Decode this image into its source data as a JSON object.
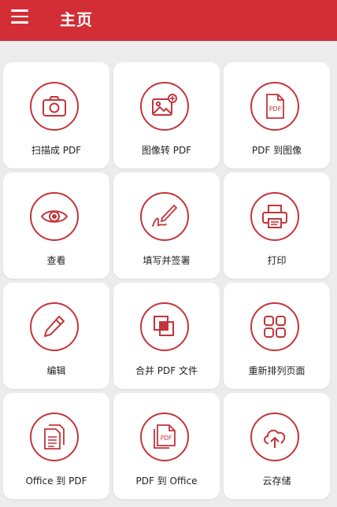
{
  "header": {
    "title": "主页"
  },
  "tiles": [
    {
      "label": "扫描成 PDF",
      "icon": "camera-icon"
    },
    {
      "label": "图像转 PDF",
      "icon": "image-add-icon"
    },
    {
      "label": "PDF 到图像",
      "icon": "pdf-file-icon",
      "icon_text": "PDF"
    },
    {
      "label": "查看",
      "icon": "eye-icon"
    },
    {
      "label": "填写并签署",
      "icon": "signature-icon"
    },
    {
      "label": "打印",
      "icon": "printer-icon"
    },
    {
      "label": "编辑",
      "icon": "pencil-icon"
    },
    {
      "label": "合并 PDF 文件",
      "icon": "merge-icon"
    },
    {
      "label": "重新排列页面",
      "icon": "grid-icon"
    },
    {
      "label": "Office 到 PDF",
      "icon": "document-icon"
    },
    {
      "label": "PDF 到 Office",
      "icon": "pdf-stack-icon",
      "icon_text": "PDF"
    },
    {
      "label": "云存储",
      "icon": "cloud-upload-icon"
    }
  ],
  "colors": {
    "accent": "#d32d35",
    "icon_stroke": "#c4343a"
  }
}
